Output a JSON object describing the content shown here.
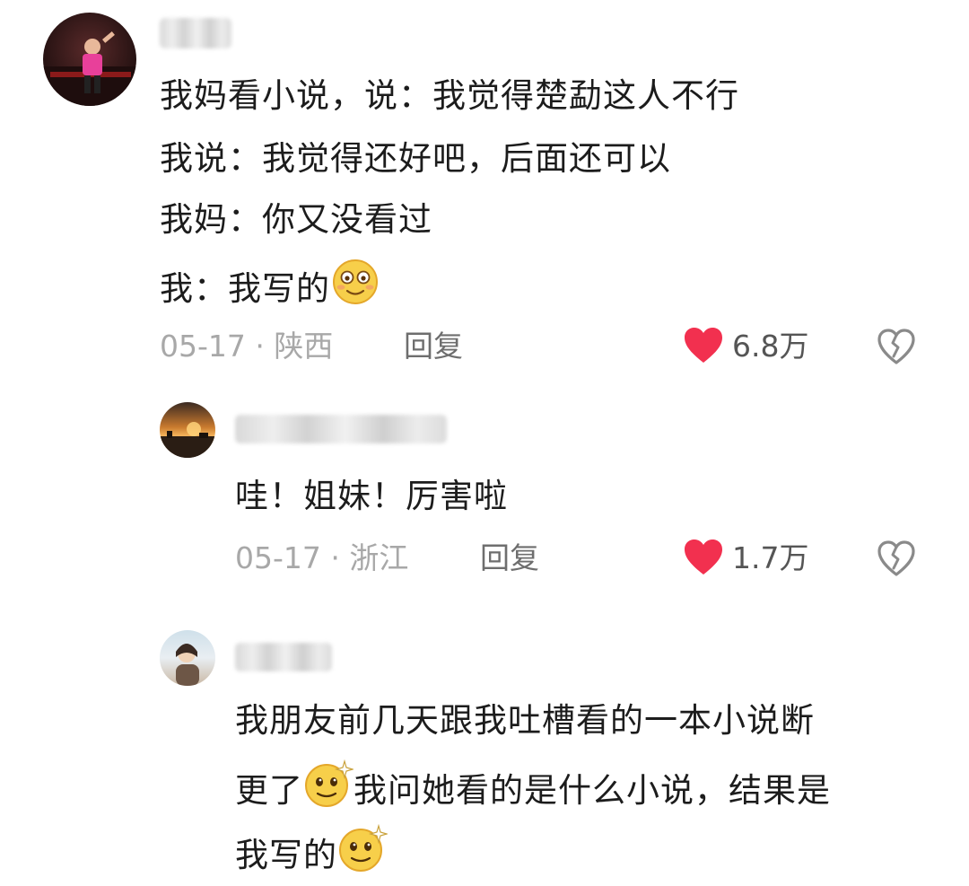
{
  "comments": [
    {
      "lines": [
        "我妈看小说，说：我觉得楚勐这人不行",
        "我说：我觉得还好吧，后面还可以",
        "我妈：你又没看过",
        "我：我写的"
      ],
      "emoji": "smile-emoji",
      "date": "05-17",
      "location": "陕西",
      "reply_label": "回复",
      "likes": "6.8万"
    },
    {
      "lines": [
        "哇！姐妹！厉害啦"
      ],
      "date": "05-17",
      "location": "浙江",
      "reply_label": "回复",
      "likes": "1.7万"
    },
    {
      "lines": [
        "我朋友前几天跟我吐槽看的一本小说断",
        "更了",
        "我问她看的是什么小说，结果是",
        "我写的"
      ],
      "emoji": "sparkle-smile-emoji"
    }
  ],
  "separator": "·",
  "colors": {
    "heart": "#f2304f",
    "meta": "#a8a8a8",
    "text": "#1c1c1c"
  }
}
